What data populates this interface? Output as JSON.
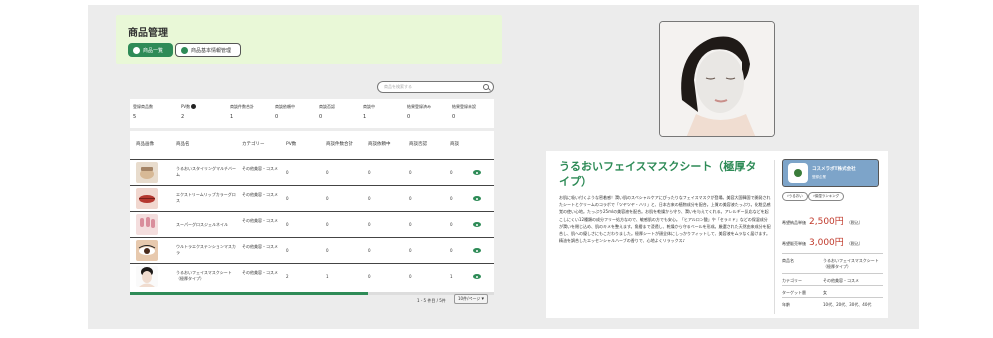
{
  "header": {
    "title": "商品管理",
    "btn_list": "商品一覧",
    "btn_info": "商品基本情報管理"
  },
  "search": {
    "placeholder": "商品を検索する"
  },
  "stats": [
    {
      "label": "登録商品数",
      "value": "5"
    },
    {
      "label": "PV数",
      "value": "2"
    },
    {
      "label": "商談件数合計",
      "value": "1"
    },
    {
      "label": "商談依頼中",
      "value": "0"
    },
    {
      "label": "商談否認",
      "value": "0"
    },
    {
      "label": "商談中",
      "value": "1"
    },
    {
      "label": "結果登録済み",
      "value": "0"
    },
    {
      "label": "結果登録未設",
      "value": "0"
    }
  ],
  "table": {
    "headers": [
      "商品画像",
      "商品名",
      "カテゴリー",
      "PV数",
      "商談件数合計",
      "商談依頼中",
      "商談否認",
      "商談"
    ],
    "rows": [
      {
        "name": "うるおいスタイリングマルチバーム",
        "category": "その他美容・コスメ",
        "pv": "0",
        "total": "0",
        "req": "0",
        "deny": "0",
        "deal": "0"
      },
      {
        "name": "エクストリームリップカラーグロス",
        "category": "その他美容・コスメ",
        "pv": "0",
        "total": "0",
        "req": "0",
        "deny": "0",
        "deal": "0"
      },
      {
        "name": "スーパーグロスジェルネイル",
        "category": "その他美容・コスメ",
        "pv": "0",
        "total": "0",
        "req": "0",
        "deny": "0",
        "deal": "0"
      },
      {
        "name": "ウルトラエクステンションマスカラ",
        "category": "その他美容・コスメ",
        "pv": "0",
        "total": "0",
        "req": "0",
        "deny": "0",
        "deal": "0"
      },
      {
        "name": "うるおいフェイスマスクシート（極厚タイプ）",
        "category": "その他美容・コスメ",
        "pv": "2",
        "total": "1",
        "req": "0",
        "deny": "0",
        "deal": "1"
      }
    ]
  },
  "pager": {
    "range": "1 - 5 件目 / 5件",
    "per_page": "10件/ページ"
  },
  "detail": {
    "title": "うるおいフェイスマスクシート（極厚タイプ）",
    "description": "お肌に吸い付くような密着感！潤い肌のスペシャルケアにぴったりなフェイスマスクが登場。美容大国韓国で開発されたシートとクリームのコラボで「ツヤツヤ・ハリ」と、日本古来の植物成分を配合。上質の美容液たっぷり。化粧品感覚の使い心地。たっぷり25mlの美容液を配合。お肌を乾燥から守り、潤いを与えてくれる。アレルギー反応などを起こしにくい12種類の成分フリー処方なので、敏感肌の方でも安心。「ヒアルロン酸」や「セラミド」などの保湿成分が潤いを閉じ込め、肌のキメを整えます。角層まで浸透し、乾燥から守るベールを形成。厳選された天然由来成分を配合し、肌への優しさにもこだわりました。極厚シートが顔全体にしっかりフィットして、美容液をムラなく届けます。精油を調合したエッセンシャルハーブの香りで、心地よくリラックス♪",
    "company_name": "コスメラボT株式会社",
    "company_sub": "登録企業",
    "tags": [
      "♯うるおい",
      "♯保湿ランキング"
    ],
    "price1_label": "希望納品単価",
    "price1": "2,500円",
    "price1_tax": "（税込）",
    "price2_label": "希望販売単価",
    "price2": "3,000円",
    "price2_tax": "（税込）",
    "specs": [
      {
        "k": "商品名",
        "v": "うるおいフェイスマスクシート（極厚タイプ）"
      },
      {
        "k": "カテゴリー",
        "v": "その他美容・コスメ"
      },
      {
        "k": "ターゲット層",
        "v": "女"
      },
      {
        "k": "年齢",
        "v": "10代、20代、30代、40代"
      }
    ]
  },
  "colors": {
    "accent": "#2e8b57",
    "header_bg": "#e9f8d7",
    "company_bg": "#7da4c9",
    "price": "#c0392b"
  }
}
